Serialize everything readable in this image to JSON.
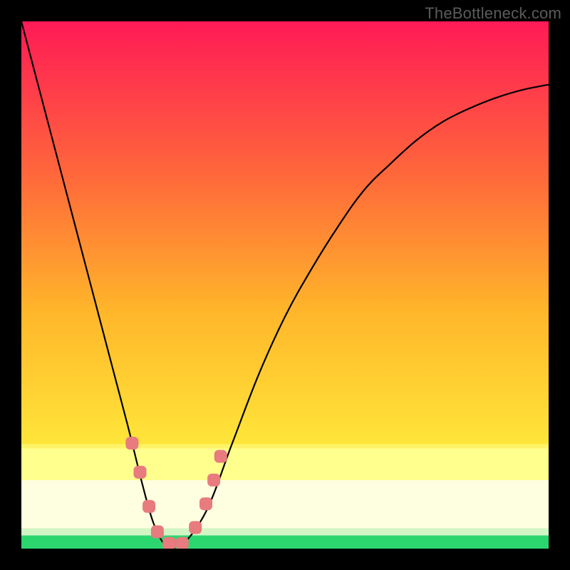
{
  "watermark": "TheBottleneck.com",
  "colors": {
    "black": "#000000",
    "curve": "#000000",
    "marker": "#e77b7e",
    "band_bright": "#ffff8e",
    "band_pale": "#feffe0",
    "green": "#2cd66f"
  },
  "chart_data": {
    "type": "line",
    "title": "",
    "xlabel": "",
    "ylabel": "",
    "xlim": [
      0,
      100
    ],
    "ylim": [
      0,
      100
    ],
    "x": [
      0,
      5,
      10,
      15,
      20,
      23,
      25,
      27,
      29,
      30,
      35,
      40,
      45,
      50,
      55,
      60,
      65,
      70,
      75,
      80,
      85,
      90,
      95,
      100
    ],
    "values": [
      100,
      81,
      62,
      43,
      24,
      12,
      5,
      1,
      0,
      0,
      7,
      20,
      33,
      44,
      53,
      61,
      68,
      73,
      77.5,
      81,
      83.5,
      85.5,
      87,
      88
    ],
    "bands": [
      {
        "name": "green-floor",
        "y0": 0,
        "y1": 2.5,
        "color": "#2cd66f"
      },
      {
        "name": "pale-yellow",
        "y0": 2.5,
        "y1": 13,
        "color": "#feffe0"
      },
      {
        "name": "bright-yellow",
        "y0": 13,
        "y1": 19,
        "color": "#ffff8e"
      }
    ],
    "gradient_stops": [
      {
        "pos": 0.0,
        "color": "#ff1a56"
      },
      {
        "pos": 0.3,
        "color": "#ff6a3a"
      },
      {
        "pos": 0.55,
        "color": "#ffb62a"
      },
      {
        "pos": 0.81,
        "color": "#ffe73a"
      },
      {
        "pos": 1.0,
        "color": "#ffe73a"
      }
    ],
    "markers": [
      {
        "x": 21.0,
        "y": 20.0
      },
      {
        "x": 22.5,
        "y": 14.5
      },
      {
        "x": 24.2,
        "y": 8.0
      },
      {
        "x": 25.8,
        "y": 3.2
      },
      {
        "x": 28.0,
        "y": 1.0
      },
      {
        "x": 30.5,
        "y": 1.0
      },
      {
        "x": 33.0,
        "y": 4.0
      },
      {
        "x": 35.0,
        "y": 8.5
      },
      {
        "x": 36.5,
        "y": 13.0
      },
      {
        "x": 37.8,
        "y": 17.5
      }
    ]
  }
}
